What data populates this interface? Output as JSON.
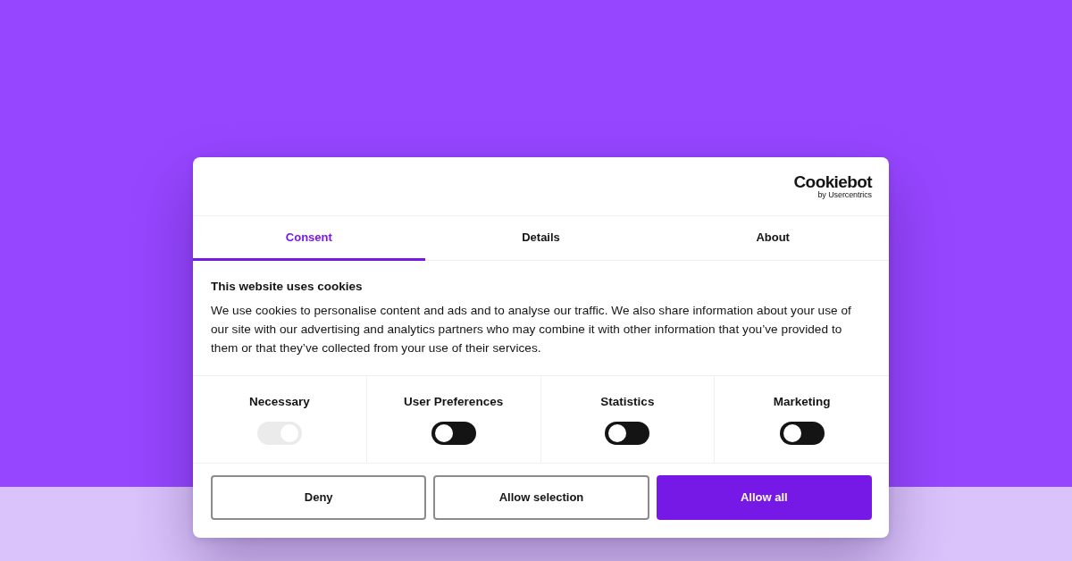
{
  "dialog": {
    "logo": {
      "wordmark": "Cookiebot",
      "byline": "by Usercentrics"
    },
    "tabs": [
      {
        "label": "Consent",
        "selected": true
      },
      {
        "label": "Details",
        "selected": false
      },
      {
        "label": "About",
        "selected": false
      }
    ],
    "title": "This website uses cookies",
    "description": "We use cookies to personalise content and ads and to analyse our traffic. We also share information about your use of our site with our advertising and analytics partners who may combine it with other information that you’ve provided to them or that they’ve collected from your use of their services.",
    "categories": [
      {
        "label": "Necessary",
        "checked": true,
        "disabled": true
      },
      {
        "label": "User Preferences",
        "checked": false,
        "disabled": false
      },
      {
        "label": "Statistics",
        "checked": false,
        "disabled": false
      },
      {
        "label": "Marketing",
        "checked": false,
        "disabled": false
      }
    ],
    "buttons": [
      {
        "label": "Deny",
        "kind": "outline"
      },
      {
        "label": "Allow selection",
        "kind": "outline"
      },
      {
        "label": "Allow all",
        "kind": "primary"
      }
    ]
  }
}
